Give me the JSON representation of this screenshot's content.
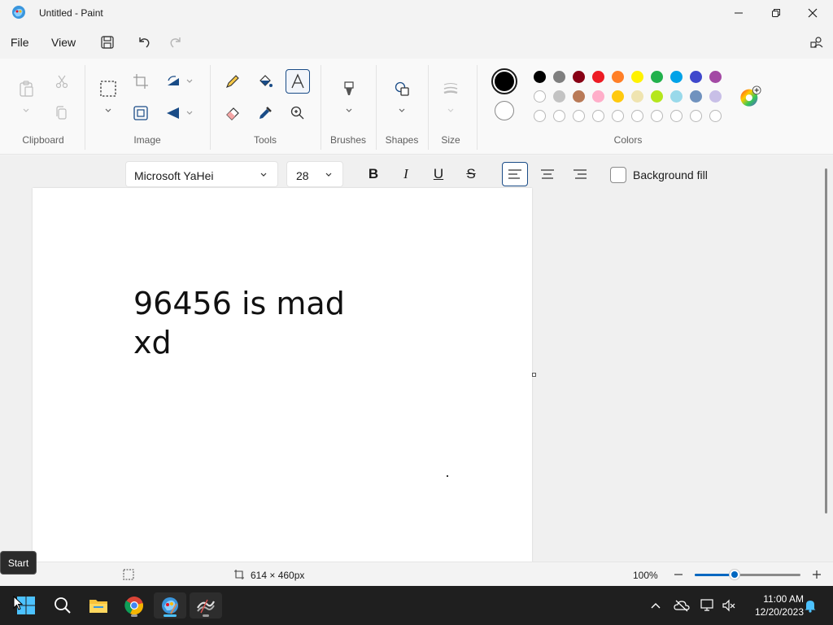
{
  "window": {
    "title": "Untitled - Paint"
  },
  "menu": {
    "file": "File",
    "view": "View"
  },
  "ribbon": {
    "groups": {
      "clipboard": "Clipboard",
      "image": "Image",
      "tools": "Tools",
      "brushes": "Brushes",
      "shapes": "Shapes",
      "size": "Size",
      "colors": "Colors"
    },
    "palette_row1": [
      "#000000",
      "#7f7f7f",
      "#880015",
      "#ed1c24",
      "#ff7f27",
      "#fff200",
      "#22b14c",
      "#00a2e8",
      "#3f48cc",
      "#a349a4"
    ],
    "palette_row2": [
      "#ffffff",
      "#c3c3c3",
      "#b97a57",
      "#ffaec9",
      "#ffc90e",
      "#efe4b0",
      "#b5e61d",
      "#99d9ea",
      "#7092be",
      "#c8bfe7"
    ],
    "primary_color": "#000000",
    "secondary_color": "#ffffff"
  },
  "text_toolbar": {
    "font_name": "Microsoft YaHei",
    "font_size": "28",
    "bold": "B",
    "italic": "I",
    "underline": "U",
    "strike": "S",
    "background_fill": "Background fill"
  },
  "canvas": {
    "text": "96456 is mad\nxd"
  },
  "status": {
    "dimensions": "614 × 460px",
    "zoom": "100%",
    "zoom_fraction": 0.38
  },
  "tooltip": {
    "text": "Start"
  },
  "taskbar": {
    "time": "11:00 AM",
    "date": "12/20/2023"
  }
}
